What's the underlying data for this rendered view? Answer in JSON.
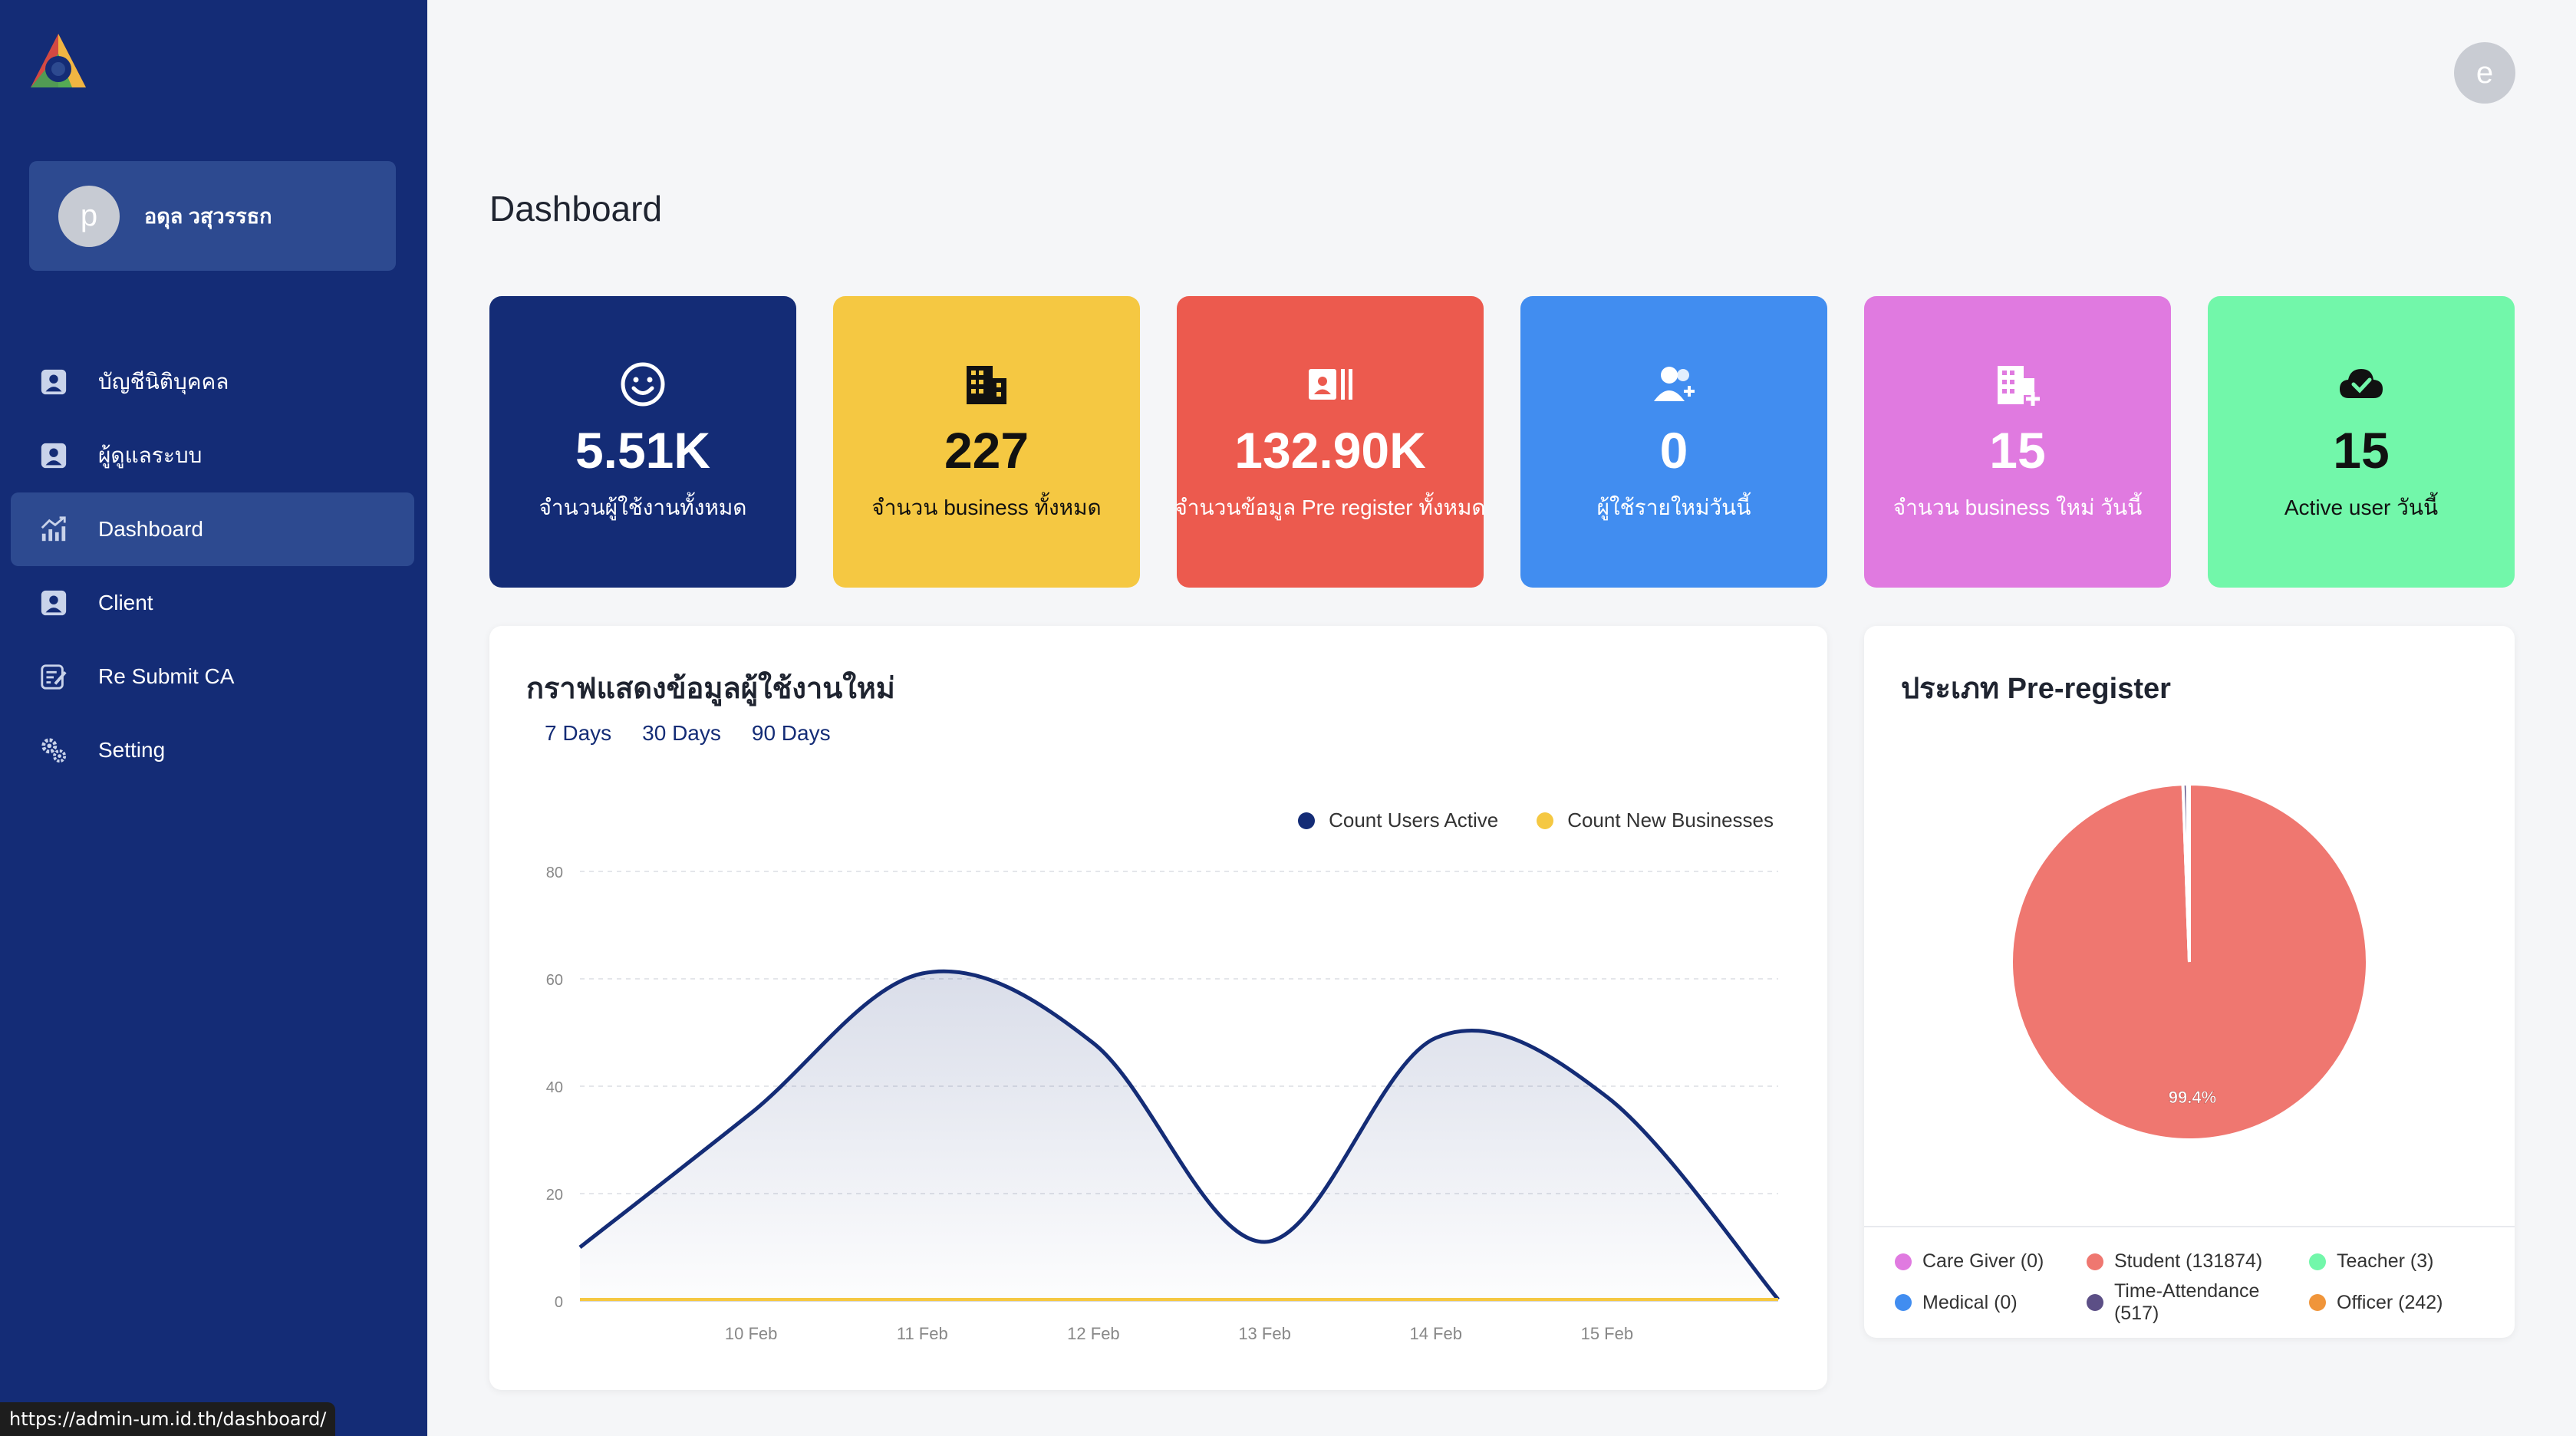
{
  "colors": {
    "sidebar": "#142c76",
    "card_navy": "#142c76",
    "card_yellow": "#f5c842",
    "card_red": "#ec5a4e",
    "card_blue": "#418df0",
    "card_pink": "#e07ae0",
    "card_green": "#72f7aa",
    "series_active": "#142c76",
    "series_business": "#f5c842"
  },
  "profile": {
    "avatar_letter": "p",
    "name": "อดุล วสุวรรธก"
  },
  "top_avatar_letter": "e",
  "sidebar": {
    "items": [
      {
        "label": "บัญชีนิติบุคคล",
        "icon": "user-badge-icon"
      },
      {
        "label": "ผู้ดูแลระบบ",
        "icon": "user-badge-icon"
      },
      {
        "label": "Dashboard",
        "icon": "chart-growth-icon"
      },
      {
        "label": "Client",
        "icon": "user-badge-icon"
      },
      {
        "label": "Re Submit CA",
        "icon": "edit-form-icon"
      },
      {
        "label": "Setting",
        "icon": "gears-icon"
      }
    ]
  },
  "page_title": "Dashboard",
  "cards": [
    {
      "value": "5.51K",
      "label": "จำนวนผู้ใช้งานทั้งหมด",
      "icon": "smile-icon"
    },
    {
      "value": "227",
      "label": "จำนวน business ทั้งหมด",
      "icon": "building-icon"
    },
    {
      "value": "132.90K",
      "label": "จำนวนข้อมูล Pre register ทั้งหมด",
      "icon": "id-card-icon"
    },
    {
      "value": "0",
      "label": "ผู้ใช้รายใหม่วันนี้",
      "icon": "user-plus-icon"
    },
    {
      "value": "15",
      "label": "จำนวน business ใหม่ วันนี้",
      "icon": "building-plus-icon"
    },
    {
      "value": "15",
      "label": "Active user วันนี้",
      "icon": "cloud-check-icon"
    }
  ],
  "line_panel": {
    "title": "กราฟแสดงข้อมูลผู้ใช้งานใหม่",
    "ranges": [
      "7 Days",
      "30 Days",
      "90 Days"
    ]
  },
  "pie_panel": {
    "title": "ประเภท Pre-register"
  },
  "status_url": "https://admin-um.id.th/dashboard/",
  "chart_data": [
    {
      "type": "area",
      "title": "กราฟแสดงข้อมูลผู้ใช้งานใหม่",
      "x": [
        "",
        "10 Feb",
        "11 Feb",
        "12 Feb",
        "13 Feb",
        "14 Feb",
        "15 Feb",
        ""
      ],
      "x_tick_labels": [
        "10 Feb",
        "11 Feb",
        "12 Feb",
        "13 Feb",
        "14 Feb",
        "15 Feb"
      ],
      "y_ticks": [
        0,
        20,
        40,
        60,
        80
      ],
      "ylim": [
        0,
        80
      ],
      "grid": true,
      "legend_position": "top-right",
      "series": [
        {
          "name": "Count Users Active",
          "values": [
            10,
            35,
            61,
            48,
            11,
            49,
            38,
            0
          ]
        },
        {
          "name": "Count New Businesses",
          "values": [
            0,
            0,
            0,
            0,
            0,
            0,
            0,
            0
          ]
        }
      ]
    },
    {
      "type": "pie",
      "title": "ประเภท Pre-register",
      "slices": [
        {
          "name": "Care Giver (0)",
          "value": 0,
          "color": "#e07ae0"
        },
        {
          "name": "Student (131874)",
          "value": 131874,
          "color": "#ef7770"
        },
        {
          "name": "Teacher (3)",
          "value": 3,
          "color": "#72f7aa"
        },
        {
          "name": "Medical (0)",
          "value": 0,
          "color": "#418df0"
        },
        {
          "name": "Time-Attendance (517)",
          "value": 517,
          "color": "#5c4f86"
        },
        {
          "name": "Officer (242)",
          "value": 242,
          "color": "#f0953a"
        }
      ],
      "data_labels": [
        "99.4%"
      ],
      "legend_position": "bottom"
    }
  ]
}
